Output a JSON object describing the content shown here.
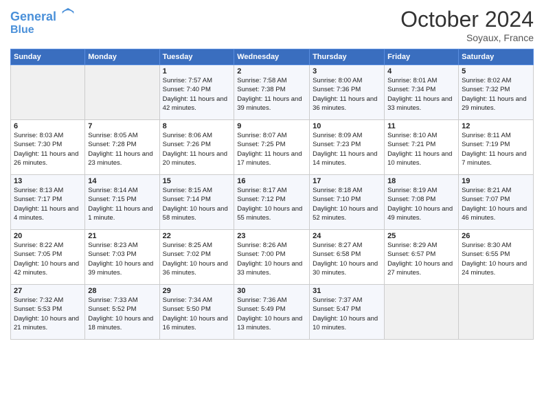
{
  "header": {
    "logo_line1": "General",
    "logo_line2": "Blue",
    "month": "October 2024",
    "location": "Soyaux, France"
  },
  "days_of_week": [
    "Sunday",
    "Monday",
    "Tuesday",
    "Wednesday",
    "Thursday",
    "Friday",
    "Saturday"
  ],
  "weeks": [
    [
      {
        "day": "",
        "info": ""
      },
      {
        "day": "",
        "info": ""
      },
      {
        "day": "1",
        "info": "Sunrise: 7:57 AM\nSunset: 7:40 PM\nDaylight: 11 hours and 42 minutes."
      },
      {
        "day": "2",
        "info": "Sunrise: 7:58 AM\nSunset: 7:38 PM\nDaylight: 11 hours and 39 minutes."
      },
      {
        "day": "3",
        "info": "Sunrise: 8:00 AM\nSunset: 7:36 PM\nDaylight: 11 hours and 36 minutes."
      },
      {
        "day": "4",
        "info": "Sunrise: 8:01 AM\nSunset: 7:34 PM\nDaylight: 11 hours and 33 minutes."
      },
      {
        "day": "5",
        "info": "Sunrise: 8:02 AM\nSunset: 7:32 PM\nDaylight: 11 hours and 29 minutes."
      }
    ],
    [
      {
        "day": "6",
        "info": "Sunrise: 8:03 AM\nSunset: 7:30 PM\nDaylight: 11 hours and 26 minutes."
      },
      {
        "day": "7",
        "info": "Sunrise: 8:05 AM\nSunset: 7:28 PM\nDaylight: 11 hours and 23 minutes."
      },
      {
        "day": "8",
        "info": "Sunrise: 8:06 AM\nSunset: 7:26 PM\nDaylight: 11 hours and 20 minutes."
      },
      {
        "day": "9",
        "info": "Sunrise: 8:07 AM\nSunset: 7:25 PM\nDaylight: 11 hours and 17 minutes."
      },
      {
        "day": "10",
        "info": "Sunrise: 8:09 AM\nSunset: 7:23 PM\nDaylight: 11 hours and 14 minutes."
      },
      {
        "day": "11",
        "info": "Sunrise: 8:10 AM\nSunset: 7:21 PM\nDaylight: 11 hours and 10 minutes."
      },
      {
        "day": "12",
        "info": "Sunrise: 8:11 AM\nSunset: 7:19 PM\nDaylight: 11 hours and 7 minutes."
      }
    ],
    [
      {
        "day": "13",
        "info": "Sunrise: 8:13 AM\nSunset: 7:17 PM\nDaylight: 11 hours and 4 minutes."
      },
      {
        "day": "14",
        "info": "Sunrise: 8:14 AM\nSunset: 7:15 PM\nDaylight: 11 hours and 1 minute."
      },
      {
        "day": "15",
        "info": "Sunrise: 8:15 AM\nSunset: 7:14 PM\nDaylight: 10 hours and 58 minutes."
      },
      {
        "day": "16",
        "info": "Sunrise: 8:17 AM\nSunset: 7:12 PM\nDaylight: 10 hours and 55 minutes."
      },
      {
        "day": "17",
        "info": "Sunrise: 8:18 AM\nSunset: 7:10 PM\nDaylight: 10 hours and 52 minutes."
      },
      {
        "day": "18",
        "info": "Sunrise: 8:19 AM\nSunset: 7:08 PM\nDaylight: 10 hours and 49 minutes."
      },
      {
        "day": "19",
        "info": "Sunrise: 8:21 AM\nSunset: 7:07 PM\nDaylight: 10 hours and 46 minutes."
      }
    ],
    [
      {
        "day": "20",
        "info": "Sunrise: 8:22 AM\nSunset: 7:05 PM\nDaylight: 10 hours and 42 minutes."
      },
      {
        "day": "21",
        "info": "Sunrise: 8:23 AM\nSunset: 7:03 PM\nDaylight: 10 hours and 39 minutes."
      },
      {
        "day": "22",
        "info": "Sunrise: 8:25 AM\nSunset: 7:02 PM\nDaylight: 10 hours and 36 minutes."
      },
      {
        "day": "23",
        "info": "Sunrise: 8:26 AM\nSunset: 7:00 PM\nDaylight: 10 hours and 33 minutes."
      },
      {
        "day": "24",
        "info": "Sunrise: 8:27 AM\nSunset: 6:58 PM\nDaylight: 10 hours and 30 minutes."
      },
      {
        "day": "25",
        "info": "Sunrise: 8:29 AM\nSunset: 6:57 PM\nDaylight: 10 hours and 27 minutes."
      },
      {
        "day": "26",
        "info": "Sunrise: 8:30 AM\nSunset: 6:55 PM\nDaylight: 10 hours and 24 minutes."
      }
    ],
    [
      {
        "day": "27",
        "info": "Sunrise: 7:32 AM\nSunset: 5:53 PM\nDaylight: 10 hours and 21 minutes."
      },
      {
        "day": "28",
        "info": "Sunrise: 7:33 AM\nSunset: 5:52 PM\nDaylight: 10 hours and 18 minutes."
      },
      {
        "day": "29",
        "info": "Sunrise: 7:34 AM\nSunset: 5:50 PM\nDaylight: 10 hours and 16 minutes."
      },
      {
        "day": "30",
        "info": "Sunrise: 7:36 AM\nSunset: 5:49 PM\nDaylight: 10 hours and 13 minutes."
      },
      {
        "day": "31",
        "info": "Sunrise: 7:37 AM\nSunset: 5:47 PM\nDaylight: 10 hours and 10 minutes."
      },
      {
        "day": "",
        "info": ""
      },
      {
        "day": "",
        "info": ""
      }
    ]
  ]
}
